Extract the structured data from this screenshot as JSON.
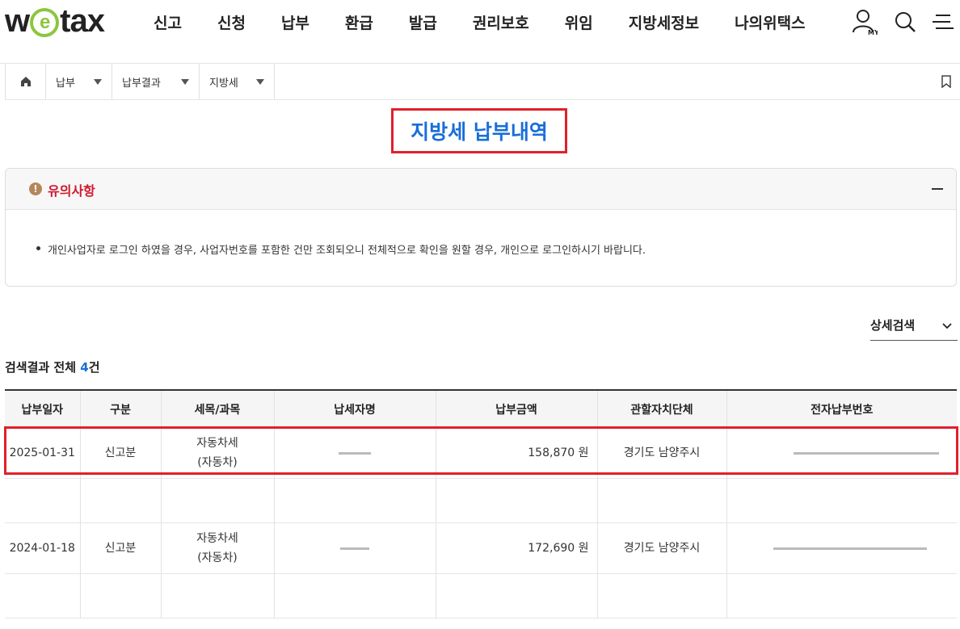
{
  "header": {
    "logo": "wetax",
    "nav": [
      "신고",
      "신청",
      "납부",
      "환급",
      "발급",
      "권리보호",
      "위임",
      "지방세정보",
      "나의위택스"
    ],
    "my_label": "MY"
  },
  "breadcrumb": [
    "납부",
    "납부결과",
    "지방세"
  ],
  "page_title": "지방세 납부내역",
  "notice": {
    "title": "유의사항",
    "items": [
      "개인사업자로 로그인 하였을 경우, 사업자번호를 포함한 건만 조회되오니 전체적으로 확인을 원할 경우, 개인으로 로그인하시기 바랍니다."
    ]
  },
  "detail_search": "상세검색",
  "result": {
    "prefix": "검색결과 전체 ",
    "count": "4",
    "suffix": "건"
  },
  "table": {
    "headers": [
      "납부일자",
      "구분",
      "세목/과목",
      "납세자명",
      "납부금액",
      "관할자치단체",
      "전자납부번호"
    ],
    "rows": [
      {
        "date": "2025-01-31",
        "type": "신고분",
        "tax1": "자동차세",
        "tax2": "(자동차)",
        "amount": "158,870 원",
        "region": "경기도 남양주시"
      },
      {
        "date": "2024-01-18",
        "type": "신고분",
        "tax1": "자동차세",
        "tax2": "(자동차)",
        "amount": "172,690 원",
        "region": "경기도 남양주시"
      }
    ]
  },
  "colors": {
    "accent_blue": "#1a6ed8",
    "highlight_red": "#e0202a",
    "notice_red": "#d0182b",
    "logo_green": "#8cc63f"
  }
}
